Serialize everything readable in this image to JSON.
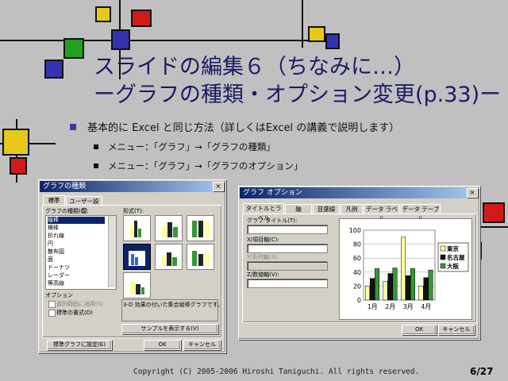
{
  "title": {
    "line1": "スライドの編集６（ちなみに…）",
    "line2": "ーグラフの種類・オプション変更(p.33)ー"
  },
  "bullets": {
    "main": "基本的に Excel と同じ方法（詳しくはExcel の講義で説明します）",
    "sub1": "メニュー：「グラフ」→「グラフの種類」",
    "sub2": "メニュー：「グラフ」→「グラフのオプション」"
  },
  "dialog_type": {
    "title": "グラフの種類",
    "close": "×",
    "tabs": [
      "標準",
      "ユーザー設定"
    ],
    "type_label": "グラフの種類(C):",
    "types": [
      "縦棒",
      "横棒",
      "折れ線",
      "円",
      "散布図",
      "面",
      "ドーナツ",
      "レーダー",
      "等高線"
    ],
    "subtype_label": "形式(T):",
    "options_label": "オプション",
    "opt_apply": "選択範囲に適用(S)",
    "opt_default": "標準の書式(D)",
    "description": "3-D 効果の付いた集合縦棒グラフです。",
    "preview_button": "サンプルを表示する(V)",
    "set_default_button": "標準グラフに設定(E)",
    "ok": "OK",
    "cancel": "キャンセル"
  },
  "dialog_options": {
    "title": "グラフ オプション",
    "close": "×",
    "tabs": [
      "タイトルとラベル",
      "軸",
      "目盛線",
      "凡例",
      "データ ラベル",
      "データ テーブル"
    ],
    "chart_title_label": "グラフ タイトル(T):",
    "x_axis_label": "X/項目軸(C):",
    "y_axis_label": "Y/系列軸(S):",
    "z_axis_label": "Z/数値軸(V):",
    "ok": "OK",
    "cancel": "キャンセル"
  },
  "chart_data": {
    "type": "bar",
    "categories": [
      "1月",
      "2月",
      "3月",
      "4月"
    ],
    "series": [
      {
        "name": "東京",
        "values": [
          20,
          27,
          90,
          20
        ]
      },
      {
        "name": "名古屋",
        "values": [
          31,
          38,
          35,
          32
        ]
      },
      {
        "name": "大阪",
        "values": [
          45,
          46,
          45,
          43
        ]
      }
    ],
    "ylim": [
      0,
      100
    ],
    "yticks": [
      "0",
      "20",
      "40",
      "60",
      "80",
      "100"
    ],
    "colors": [
      "#ffff99",
      "#111111",
      "#339933"
    ]
  },
  "footer": {
    "copyright": "Copyright (C) 2005-2006 Hiroshi Taniguchi. All rights reserved.",
    "page": "6/27"
  },
  "colors": {
    "background": "#c0c0c0",
    "title": "#1a1a66",
    "titlebar": "#0a246a"
  }
}
